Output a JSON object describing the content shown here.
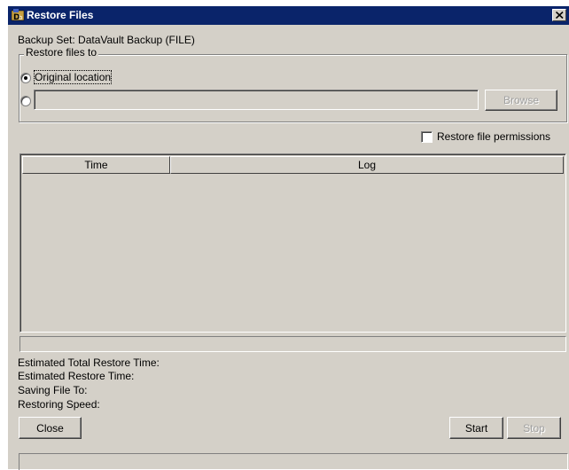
{
  "window": {
    "title": "Restore Files",
    "app_icon": "datavault-icon",
    "close_icon": "close-icon"
  },
  "backup_set_label": "Backup Set: DataVault Backup (FILE)",
  "restore_to": {
    "legend": "Restore files to",
    "original_location": {
      "label": "Original location",
      "selected": true
    },
    "custom_location": {
      "selected": false,
      "path_value": ""
    },
    "browse_label": "Browse",
    "browse_enabled": false
  },
  "restore_permissions": {
    "label": "Restore file permissions",
    "checked": false
  },
  "log_table": {
    "columns": [
      "Time",
      "Log"
    ],
    "rows": []
  },
  "progress": {
    "value": 0
  },
  "info": {
    "estimated_total": "Estimated Total Restore Time:",
    "estimated_restore": "Estimated Restore Time:",
    "saving_to": "Saving File To:",
    "speed": "Restoring Speed:"
  },
  "buttons": {
    "close": "Close",
    "start": "Start",
    "stop": "Stop",
    "stop_enabled": false
  },
  "status_text": "",
  "colors": {
    "titlebar": "#0a246a",
    "panel": "#d4d0c8",
    "disabled_text": "#a0a0a0"
  }
}
